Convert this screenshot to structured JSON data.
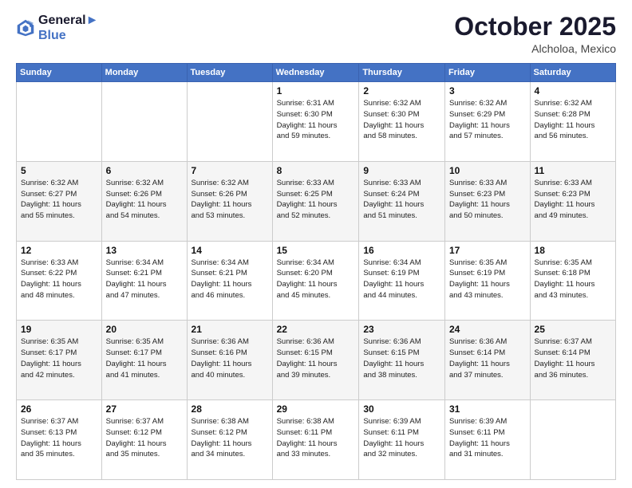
{
  "header": {
    "logo": {
      "line1": "General",
      "line2": "Blue"
    },
    "title": "October 2025",
    "location": "Alcholoa, Mexico"
  },
  "weekdays": [
    "Sunday",
    "Monday",
    "Tuesday",
    "Wednesday",
    "Thursday",
    "Friday",
    "Saturday"
  ],
  "weeks": [
    [
      {
        "day": "",
        "info": ""
      },
      {
        "day": "",
        "info": ""
      },
      {
        "day": "",
        "info": ""
      },
      {
        "day": "1",
        "info": "Sunrise: 6:31 AM\nSunset: 6:30 PM\nDaylight: 11 hours\nand 59 minutes."
      },
      {
        "day": "2",
        "info": "Sunrise: 6:32 AM\nSunset: 6:30 PM\nDaylight: 11 hours\nand 58 minutes."
      },
      {
        "day": "3",
        "info": "Sunrise: 6:32 AM\nSunset: 6:29 PM\nDaylight: 11 hours\nand 57 minutes."
      },
      {
        "day": "4",
        "info": "Sunrise: 6:32 AM\nSunset: 6:28 PM\nDaylight: 11 hours\nand 56 minutes."
      }
    ],
    [
      {
        "day": "5",
        "info": "Sunrise: 6:32 AM\nSunset: 6:27 PM\nDaylight: 11 hours\nand 55 minutes."
      },
      {
        "day": "6",
        "info": "Sunrise: 6:32 AM\nSunset: 6:26 PM\nDaylight: 11 hours\nand 54 minutes."
      },
      {
        "day": "7",
        "info": "Sunrise: 6:32 AM\nSunset: 6:26 PM\nDaylight: 11 hours\nand 53 minutes."
      },
      {
        "day": "8",
        "info": "Sunrise: 6:33 AM\nSunset: 6:25 PM\nDaylight: 11 hours\nand 52 minutes."
      },
      {
        "day": "9",
        "info": "Sunrise: 6:33 AM\nSunset: 6:24 PM\nDaylight: 11 hours\nand 51 minutes."
      },
      {
        "day": "10",
        "info": "Sunrise: 6:33 AM\nSunset: 6:23 PM\nDaylight: 11 hours\nand 50 minutes."
      },
      {
        "day": "11",
        "info": "Sunrise: 6:33 AM\nSunset: 6:23 PM\nDaylight: 11 hours\nand 49 minutes."
      }
    ],
    [
      {
        "day": "12",
        "info": "Sunrise: 6:33 AM\nSunset: 6:22 PM\nDaylight: 11 hours\nand 48 minutes."
      },
      {
        "day": "13",
        "info": "Sunrise: 6:34 AM\nSunset: 6:21 PM\nDaylight: 11 hours\nand 47 minutes."
      },
      {
        "day": "14",
        "info": "Sunrise: 6:34 AM\nSunset: 6:21 PM\nDaylight: 11 hours\nand 46 minutes."
      },
      {
        "day": "15",
        "info": "Sunrise: 6:34 AM\nSunset: 6:20 PM\nDaylight: 11 hours\nand 45 minutes."
      },
      {
        "day": "16",
        "info": "Sunrise: 6:34 AM\nSunset: 6:19 PM\nDaylight: 11 hours\nand 44 minutes."
      },
      {
        "day": "17",
        "info": "Sunrise: 6:35 AM\nSunset: 6:19 PM\nDaylight: 11 hours\nand 43 minutes."
      },
      {
        "day": "18",
        "info": "Sunrise: 6:35 AM\nSunset: 6:18 PM\nDaylight: 11 hours\nand 43 minutes."
      }
    ],
    [
      {
        "day": "19",
        "info": "Sunrise: 6:35 AM\nSunset: 6:17 PM\nDaylight: 11 hours\nand 42 minutes."
      },
      {
        "day": "20",
        "info": "Sunrise: 6:35 AM\nSunset: 6:17 PM\nDaylight: 11 hours\nand 41 minutes."
      },
      {
        "day": "21",
        "info": "Sunrise: 6:36 AM\nSunset: 6:16 PM\nDaylight: 11 hours\nand 40 minutes."
      },
      {
        "day": "22",
        "info": "Sunrise: 6:36 AM\nSunset: 6:15 PM\nDaylight: 11 hours\nand 39 minutes."
      },
      {
        "day": "23",
        "info": "Sunrise: 6:36 AM\nSunset: 6:15 PM\nDaylight: 11 hours\nand 38 minutes."
      },
      {
        "day": "24",
        "info": "Sunrise: 6:36 AM\nSunset: 6:14 PM\nDaylight: 11 hours\nand 37 minutes."
      },
      {
        "day": "25",
        "info": "Sunrise: 6:37 AM\nSunset: 6:14 PM\nDaylight: 11 hours\nand 36 minutes."
      }
    ],
    [
      {
        "day": "26",
        "info": "Sunrise: 6:37 AM\nSunset: 6:13 PM\nDaylight: 11 hours\nand 35 minutes."
      },
      {
        "day": "27",
        "info": "Sunrise: 6:37 AM\nSunset: 6:12 PM\nDaylight: 11 hours\nand 35 minutes."
      },
      {
        "day": "28",
        "info": "Sunrise: 6:38 AM\nSunset: 6:12 PM\nDaylight: 11 hours\nand 34 minutes."
      },
      {
        "day": "29",
        "info": "Sunrise: 6:38 AM\nSunset: 6:11 PM\nDaylight: 11 hours\nand 33 minutes."
      },
      {
        "day": "30",
        "info": "Sunrise: 6:39 AM\nSunset: 6:11 PM\nDaylight: 11 hours\nand 32 minutes."
      },
      {
        "day": "31",
        "info": "Sunrise: 6:39 AM\nSunset: 6:11 PM\nDaylight: 11 hours\nand 31 minutes."
      },
      {
        "day": "",
        "info": ""
      }
    ]
  ]
}
